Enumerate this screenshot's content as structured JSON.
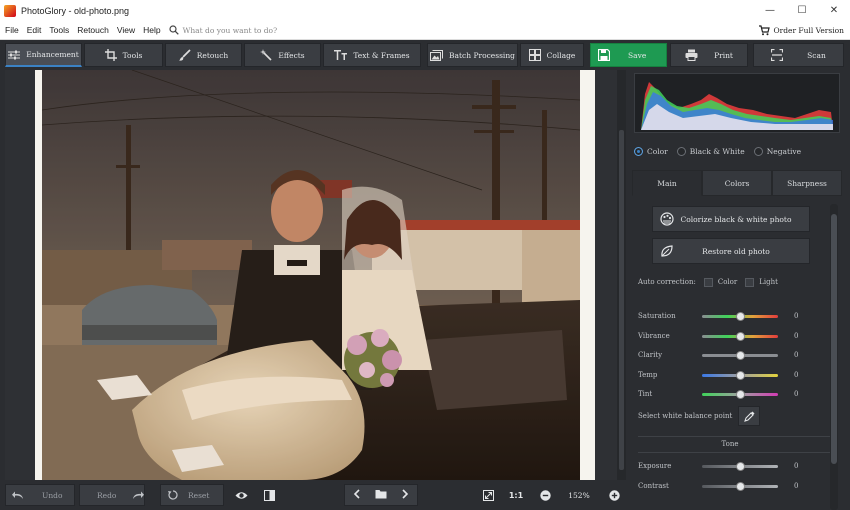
{
  "window": {
    "title": "PhotoGlory - old-photo.png",
    "controls": {
      "minimize": "—",
      "maximize": "☐",
      "close": "✕"
    }
  },
  "menu": {
    "items": [
      "File",
      "Edit",
      "Tools",
      "Retouch",
      "View",
      "Help"
    ],
    "search_placeholder": "What do you want to do?",
    "order": "Order Full Version"
  },
  "toolbar": {
    "enhancement": "Enhancement",
    "tools": "Tools",
    "retouch": "Retouch",
    "effects": "Effects",
    "text_frames": "Text & Frames",
    "batch": "Batch Processing",
    "collage": "Collage",
    "save": "Save",
    "print": "Print",
    "scan": "Scan"
  },
  "bottom": {
    "undo": "Undo",
    "redo": "Redo",
    "reset": "Reset",
    "fit": "1:1",
    "zoom": "152%"
  },
  "panel": {
    "modes": [
      {
        "label": "Color",
        "selected": true
      },
      {
        "label": "Black & White",
        "selected": false
      },
      {
        "label": "Negative",
        "selected": false
      }
    ],
    "tabs": [
      {
        "label": "Main",
        "active": true
      },
      {
        "label": "Colors",
        "active": false
      },
      {
        "label": "Sharpness",
        "active": false
      }
    ],
    "colorize": "Colorize black & white photo",
    "restore": "Restore old photo",
    "auto_correction": "Auto correction:",
    "auto_color": "Color",
    "auto_light": "Light",
    "sliders": [
      {
        "label": "Saturation",
        "value": "0"
      },
      {
        "label": "Vibrance",
        "value": "0"
      },
      {
        "label": "Clarity",
        "value": "0"
      },
      {
        "label": "Temp",
        "value": "0"
      },
      {
        "label": "Tint",
        "value": "0"
      }
    ],
    "white_balance": "Select white balance point",
    "tone_title": "Tone",
    "tone_sliders": [
      {
        "label": "Exposure",
        "value": "0"
      },
      {
        "label": "Contrast",
        "value": "0"
      }
    ]
  },
  "colors": {
    "accent": "#3b82c4",
    "save": "#1e9a52"
  }
}
